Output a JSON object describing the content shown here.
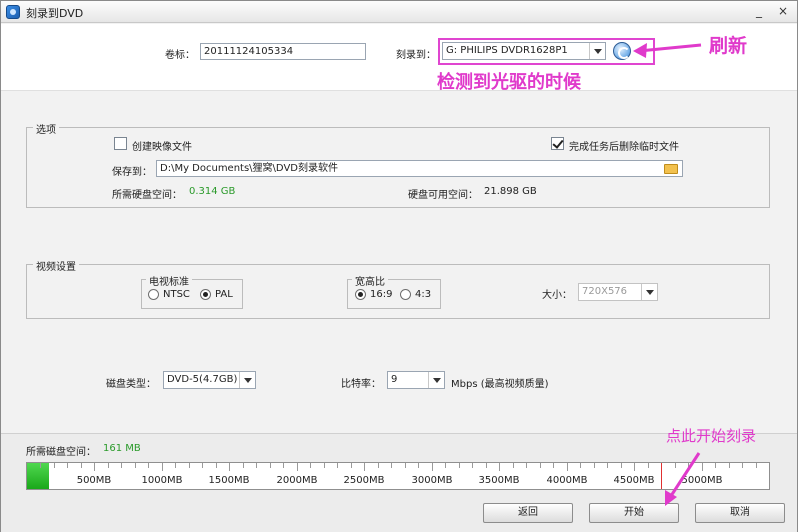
{
  "window": {
    "title": "刻录到DVD",
    "minimize": "_",
    "close": "×"
  },
  "top": {
    "volume_label": "卷标：",
    "volume_value": "20111124105334",
    "burner_label": "刻录到：",
    "burner_value": "G: PHILIPS  DVDR1628P1"
  },
  "annotations": {
    "refresh": "刷新",
    "detected": "检测到光驱的时候",
    "start_here": "点此开始刻录"
  },
  "options": {
    "title": "选项",
    "create_image_label": "创建映像文件",
    "create_image_checked": false,
    "delete_temp_label": "完成任务后删除临时文件",
    "delete_temp_checked": true,
    "save_to_label": "保存到：",
    "save_to_value": "D:\\My Documents\\狸窝\\DVD刻录软件",
    "required_space_label": "所需硬盘空间：",
    "required_space_value": "0.314 GB",
    "available_space_label": "硬盘可用空间：",
    "available_space_value": "21.898 GB"
  },
  "video": {
    "title": "视频设置",
    "tv_standard_title": "电视标准",
    "ntsc_label": "NTSC",
    "pal_label": "PAL",
    "selected_standard": "PAL",
    "aspect_title": "宽高比",
    "aspect_169_label": "16:9",
    "aspect_43_label": "4:3",
    "selected_aspect": "16:9",
    "size_label": "大小：",
    "size_value": "720X576"
  },
  "disc": {
    "type_label": "磁盘类型：",
    "type_value": "DVD-5(4.7GB)",
    "bitrate_label": "比特率：",
    "bitrate_value": "9",
    "bitrate_unit": "Mbps (最高视频质量)"
  },
  "space_meter": {
    "label": "所需磁盘空间：",
    "value_text": "161 MB",
    "used_mb": 161,
    "limit_mb": 4700,
    "max_mb": 5500,
    "major_ticks": [
      {
        "mb": 500,
        "label": "500MB"
      },
      {
        "mb": 1000,
        "label": "1000MB"
      },
      {
        "mb": 1500,
        "label": "1500MB"
      },
      {
        "mb": 2000,
        "label": "2000MB"
      },
      {
        "mb": 2500,
        "label": "2500MB"
      },
      {
        "mb": 3000,
        "label": "3000MB"
      },
      {
        "mb": 3500,
        "label": "3500MB"
      },
      {
        "mb": 4000,
        "label": "4000MB"
      },
      {
        "mb": 4500,
        "label": "4500MB"
      },
      {
        "mb": 5000,
        "label": "5000MB"
      }
    ],
    "fill_color": "#1aa81a",
    "limit_color": "#e03030"
  },
  "buttons": {
    "back": "返回",
    "start": "开始",
    "cancel": "取消"
  },
  "colors": {
    "annotation": "#e03acb"
  }
}
